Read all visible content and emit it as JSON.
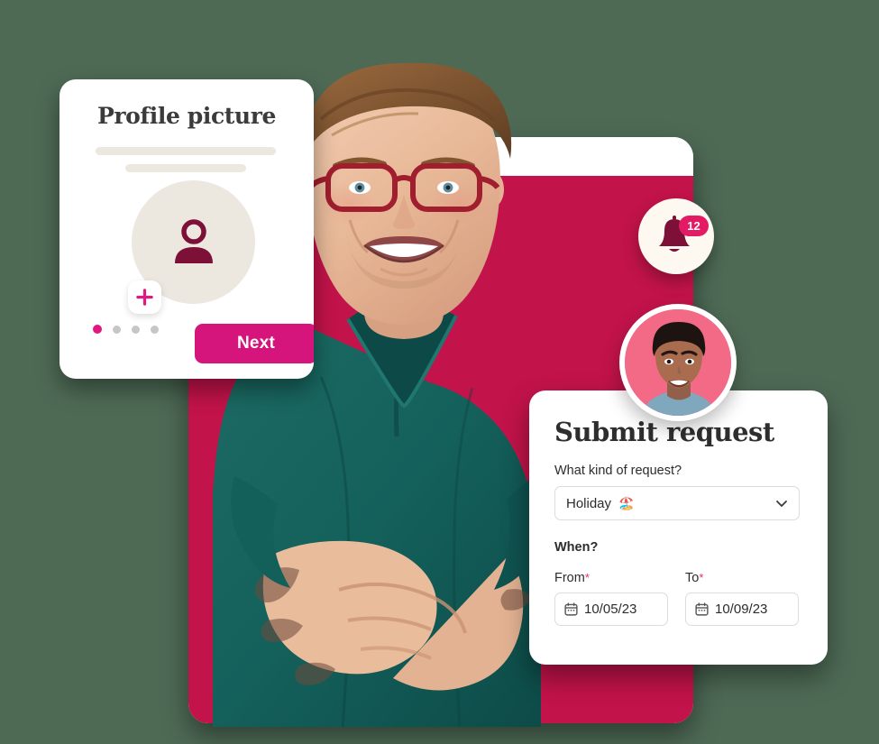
{
  "theme": {
    "background_green": "#4e6a55",
    "crimson": "#c2134a",
    "magenta": "#d6157c",
    "pink_accent": "#e0197f",
    "badge_red": "#e31b64",
    "cream": "#ece7df",
    "dark_text": "#2e2e2e"
  },
  "profile_card": {
    "title": "Profile picture",
    "avatar_icon": "person-icon",
    "add_photo_icon": "plus-icon",
    "next_label": "Next",
    "dots": [
      {
        "active": true
      },
      {
        "active": false
      },
      {
        "active": false
      },
      {
        "active": false
      }
    ]
  },
  "notification": {
    "icon": "bell-icon",
    "count": "12"
  },
  "avatar_bubble": {
    "name": "user-avatar"
  },
  "request_card": {
    "title": "Submit request",
    "kind_label": "What kind of request?",
    "kind_value": "Holiday",
    "kind_emoji": "🏖️",
    "chevron_icon": "chevron-down-icon",
    "when_label": "When?",
    "from_label": "From",
    "to_label": "To",
    "required_mark": "*",
    "calendar_icon": "calendar-icon",
    "from_value": "10/05/23",
    "to_value": "10/09/23"
  }
}
